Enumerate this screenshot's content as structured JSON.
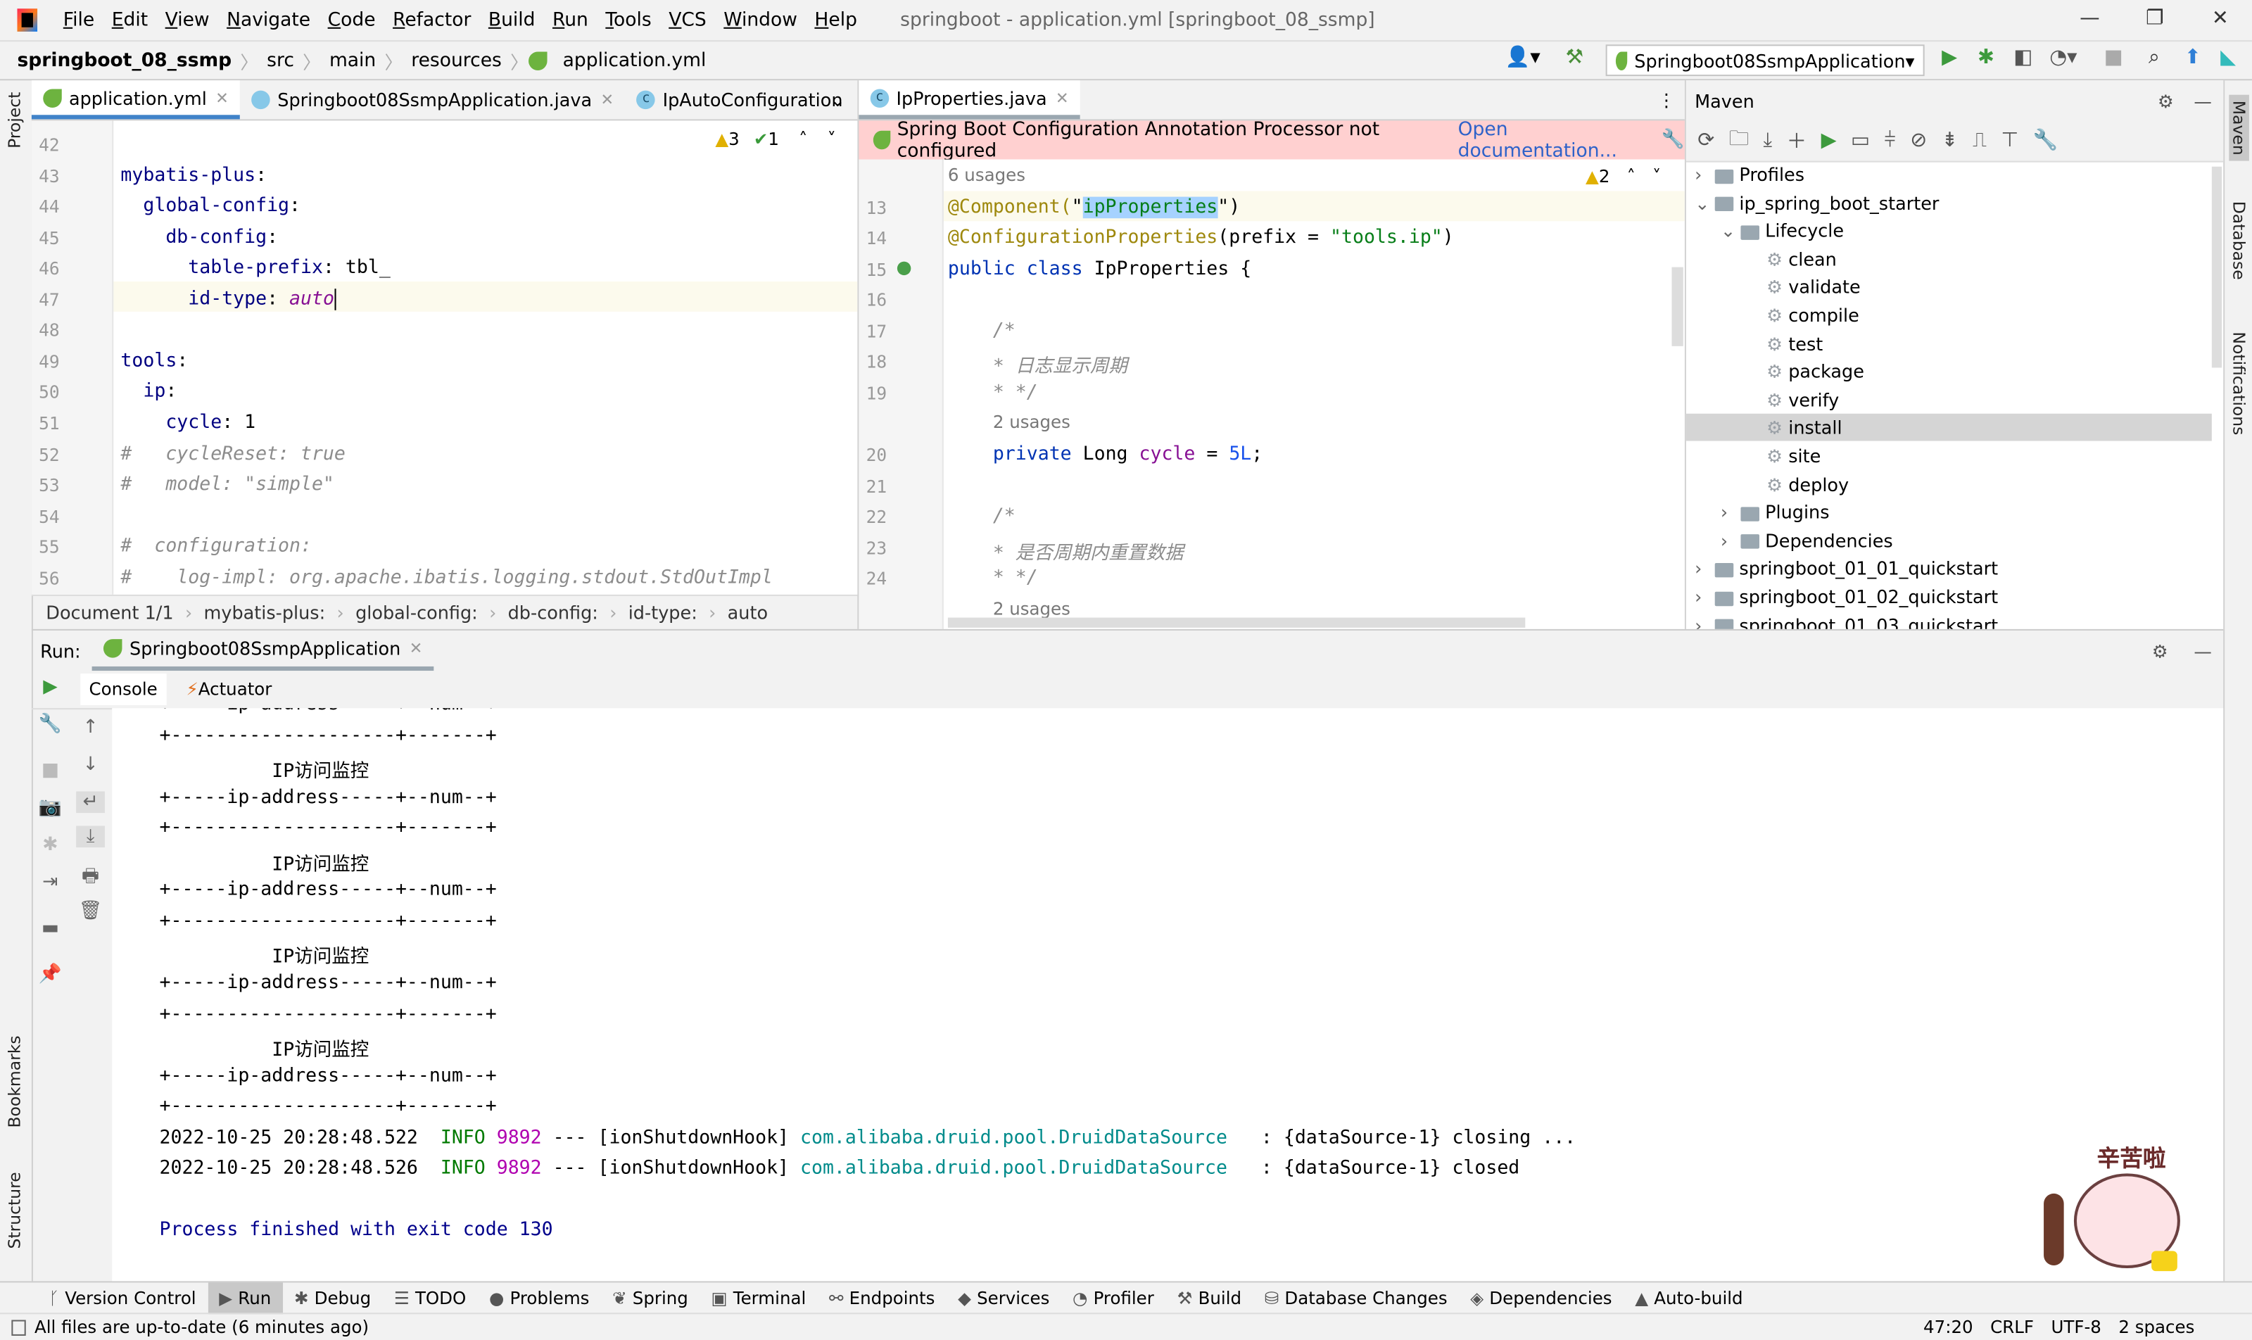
{
  "menu": [
    "File",
    "Edit",
    "View",
    "Navigate",
    "Code",
    "Refactor",
    "Build",
    "Run",
    "Tools",
    "VCS",
    "Window",
    "Help"
  ],
  "window_title": "springboot - application.yml [springboot_08_ssmp]",
  "breadcrumb": [
    "springboot_08_ssmp",
    "src",
    "main",
    "resources",
    "application.yml"
  ],
  "run_config": "Springboot08SsmpApplication",
  "left_strip": [
    "Project",
    "Bookmarks",
    "Structure"
  ],
  "right_strip": [
    "Maven",
    "Database",
    "Notifications"
  ],
  "editor1": {
    "tabs": [
      {
        "label": "application.yml",
        "icon": "spring"
      },
      {
        "label": "Springboot08SsmpApplication.java",
        "icon": "spring-class"
      },
      {
        "label": "IpAutoConfiguration",
        "icon": "class"
      }
    ],
    "warnings": "3",
    "checks": "1",
    "lines": [
      {
        "n": "42",
        "tokens": []
      },
      {
        "n": "43",
        "tokens": [
          {
            "t": "mybatis-plus",
            "c": "key"
          },
          {
            "t": ":"
          }
        ]
      },
      {
        "n": "44",
        "tokens": [
          {
            "t": "  "
          },
          {
            "t": "global-config",
            "c": "key"
          },
          {
            "t": ":"
          }
        ]
      },
      {
        "n": "45",
        "tokens": [
          {
            "t": "    "
          },
          {
            "t": "db-config",
            "c": "key"
          },
          {
            "t": ":"
          }
        ]
      },
      {
        "n": "46",
        "tokens": [
          {
            "t": "      "
          },
          {
            "t": "table-prefix",
            "c": "key"
          },
          {
            "t": ": tbl_"
          }
        ]
      },
      {
        "n": "47",
        "tokens": [
          {
            "t": "      "
          },
          {
            "t": "id-type",
            "c": "key"
          },
          {
            "t": ": "
          },
          {
            "t": "auto",
            "c": "it caret"
          }
        ]
      },
      {
        "n": "48",
        "tokens": []
      },
      {
        "n": "49",
        "tokens": [
          {
            "t": "tools",
            "c": "key"
          },
          {
            "t": ":"
          }
        ]
      },
      {
        "n": "50",
        "tokens": [
          {
            "t": "  "
          },
          {
            "t": "ip",
            "c": "key"
          },
          {
            "t": ":"
          }
        ]
      },
      {
        "n": "51",
        "tokens": [
          {
            "t": "    "
          },
          {
            "t": "cycle",
            "c": "key"
          },
          {
            "t": ": 1"
          }
        ]
      },
      {
        "n": "52",
        "tokens": [
          {
            "t": "#   cycleReset: true",
            "c": "cm"
          }
        ]
      },
      {
        "n": "53",
        "tokens": [
          {
            "t": "#   model: \"simple\"",
            "c": "cm"
          }
        ]
      },
      {
        "n": "54",
        "tokens": []
      },
      {
        "n": "55",
        "tokens": [
          {
            "t": "#  configuration:",
            "c": "cm"
          }
        ]
      },
      {
        "n": "56",
        "tokens": [
          {
            "t": "#    log-impl: org.apache.ibatis.logging.stdout.StdOutImpl",
            "c": "cm"
          }
        ]
      }
    ],
    "path": [
      "Document 1/1",
      "mybatis-plus:",
      "global-config:",
      "db-config:",
      "id-type:",
      "auto"
    ]
  },
  "editor2": {
    "tab": "IpProperties.java",
    "banner": "Spring Boot Configuration Annotation Processor not configured",
    "banner_link": "Open documentation...",
    "warnings": "2",
    "lines": [
      {
        "n": "",
        "tokens": [
          {
            "t": "6 usages",
            "c": "hint"
          }
        ]
      },
      {
        "n": "13",
        "tokens": [
          {
            "t": "@Component(",
            "c": "an"
          },
          {
            "t": "\""
          },
          {
            "t": "ipProperties",
            "c": "s sel"
          },
          {
            "t": "\""
          },
          {
            "t": ")"
          }
        ]
      },
      {
        "n": "14",
        "tokens": [
          {
            "t": "@ConfigurationProperties",
            "c": "an"
          },
          {
            "t": "(prefix = "
          },
          {
            "t": "\"tools.ip\"",
            "c": "s"
          },
          {
            "t": ")"
          }
        ]
      },
      {
        "n": "15",
        "tokens": [
          {
            "t": "public class ",
            "c": "kw"
          },
          {
            "t": "IpProperties {"
          }
        ]
      },
      {
        "n": "16",
        "tokens": []
      },
      {
        "n": "17",
        "tokens": [
          {
            "t": "    /*",
            "c": "cm"
          }
        ]
      },
      {
        "n": "18",
        "tokens": [
          {
            "t": "    * 日志显示周期",
            "c": "cm"
          }
        ]
      },
      {
        "n": "19",
        "tokens": [
          {
            "t": "    * */",
            "c": "cm"
          }
        ]
      },
      {
        "n": "",
        "tokens": [
          {
            "t": "    "
          },
          {
            "t": "2 usages",
            "c": "hint"
          }
        ]
      },
      {
        "n": "20",
        "tokens": [
          {
            "t": "    "
          },
          {
            "t": "private ",
            "c": "kw"
          },
          {
            "t": "Long "
          },
          {
            "t": "cycle",
            "c": "fld"
          },
          {
            "t": " = "
          },
          {
            "t": "5L",
            "c": "num"
          },
          {
            "t": ";"
          }
        ]
      },
      {
        "n": "21",
        "tokens": []
      },
      {
        "n": "22",
        "tokens": [
          {
            "t": "    /*",
            "c": "cm"
          }
        ]
      },
      {
        "n": "23",
        "tokens": [
          {
            "t": "    * 是否周期内重置数据",
            "c": "cm"
          }
        ]
      },
      {
        "n": "24",
        "tokens": [
          {
            "t": "    * */",
            "c": "cm"
          }
        ]
      },
      {
        "n": "",
        "tokens": [
          {
            "t": "    "
          },
          {
            "t": "2 usages",
            "c": "hint"
          }
        ]
      }
    ]
  },
  "maven": {
    "title": "Maven",
    "items": [
      {
        "label": "Profiles",
        "level": 0,
        "chev": ">",
        "icon": "folder"
      },
      {
        "label": "ip_spring_boot_starter",
        "level": 0,
        "chev": "v",
        "icon": "module"
      },
      {
        "label": "Lifecycle",
        "level": 1,
        "chev": "v",
        "icon": "folder"
      },
      {
        "label": "clean",
        "level": 2,
        "icon": "gear"
      },
      {
        "label": "validate",
        "level": 2,
        "icon": "gear"
      },
      {
        "label": "compile",
        "level": 2,
        "icon": "gear"
      },
      {
        "label": "test",
        "level": 2,
        "icon": "gear"
      },
      {
        "label": "package",
        "level": 2,
        "icon": "gear"
      },
      {
        "label": "verify",
        "level": 2,
        "icon": "gear"
      },
      {
        "label": "install",
        "level": 2,
        "icon": "gear",
        "selected": true
      },
      {
        "label": "site",
        "level": 2,
        "icon": "gear"
      },
      {
        "label": "deploy",
        "level": 2,
        "icon": "gear"
      },
      {
        "label": "Plugins",
        "level": 1,
        "chev": ">",
        "icon": "folder"
      },
      {
        "label": "Dependencies",
        "level": 1,
        "chev": ">",
        "icon": "folder"
      },
      {
        "label": "springboot_01_01_quickstart",
        "level": 0,
        "chev": ">",
        "icon": "module"
      },
      {
        "label": "springboot_01_02_quickstart",
        "level": 0,
        "chev": ">",
        "icon": "module"
      },
      {
        "label": "springboot_01_03_quickstart",
        "level": 0,
        "chev": ">",
        "icon": "module"
      }
    ]
  },
  "run": {
    "label": "Run:",
    "tab": "Springboot08SsmpApplication",
    "subtabs": [
      "Console",
      "Actuator"
    ],
    "console": [
      [
        {
          "t": "+-----ip-address-----+--num--+"
        }
      ],
      [
        {
          "t": "+--------------------+-------+"
        }
      ],
      [
        {
          "t": "          IP访问监控"
        }
      ],
      [
        {
          "t": "+-----ip-address-----+--num--+"
        }
      ],
      [
        {
          "t": "+--------------------+-------+"
        }
      ],
      [
        {
          "t": "          IP访问监控"
        }
      ],
      [
        {
          "t": "+-----ip-address-----+--num--+"
        }
      ],
      [
        {
          "t": "+--------------------+-------+"
        }
      ],
      [
        {
          "t": "          IP访问监控"
        }
      ],
      [
        {
          "t": "+-----ip-address-----+--num--+"
        }
      ],
      [
        {
          "t": "+--------------------+-------+"
        }
      ],
      [
        {
          "t": "          IP访问监控"
        }
      ],
      [
        {
          "t": "+-----ip-address-----+--num--+"
        }
      ],
      [
        {
          "t": "+--------------------+-------+"
        }
      ],
      [
        {
          "t": "2022-10-25 20:28:48.522  "
        },
        {
          "t": "INFO",
          "c": "info"
        },
        {
          "t": " "
        },
        {
          "t": "9892",
          "c": "pid"
        },
        {
          "t": " --- [ionShutdownHook] "
        },
        {
          "t": "com.alibaba.druid.pool.DruidDataSource",
          "c": "cls"
        },
        {
          "t": "   : {dataSource-1} closing ..."
        }
      ],
      [
        {
          "t": "2022-10-25 20:28:48.526  "
        },
        {
          "t": "INFO",
          "c": "info"
        },
        {
          "t": " "
        },
        {
          "t": "9892",
          "c": "pid"
        },
        {
          "t": " --- [ionShutdownHook] "
        },
        {
          "t": "com.alibaba.druid.pool.DruidDataSource",
          "c": "cls"
        },
        {
          "t": "   : {dataSource-1} closed"
        }
      ],
      [],
      [
        {
          "t": "Process finished with exit code 130",
          "c": "exit"
        }
      ]
    ],
    "sticker_text": "辛苦啦"
  },
  "bottom_tabs": [
    {
      "label": "Version Control",
      "icon": "branch-icon",
      "glyph": "ᚴ"
    },
    {
      "label": "Run",
      "icon": "run-icon",
      "glyph": "▶",
      "active": true
    },
    {
      "label": "Debug",
      "icon": "bug-icon",
      "glyph": "✱"
    },
    {
      "label": "TODO",
      "icon": "list-icon",
      "glyph": "☰"
    },
    {
      "label": "Problems",
      "icon": "problems-icon",
      "glyph": "●"
    },
    {
      "label": "Spring",
      "icon": "spring-icon",
      "glyph": "❦"
    },
    {
      "label": "Terminal",
      "icon": "terminal-icon",
      "glyph": "▣"
    },
    {
      "label": "Endpoints",
      "icon": "endpoints-icon",
      "glyph": "⚯"
    },
    {
      "label": "Services",
      "icon": "services-icon",
      "glyph": "◆"
    },
    {
      "label": "Profiler",
      "icon": "profiler-icon",
      "glyph": "◔"
    },
    {
      "label": "Build",
      "icon": "hammer-icon",
      "glyph": "⚒"
    },
    {
      "label": "Database Changes",
      "icon": "database-icon",
      "glyph": "⛁"
    },
    {
      "label": "Dependencies",
      "icon": "dependencies-icon",
      "glyph": "◈"
    },
    {
      "label": "Auto-build",
      "icon": "warning-icon",
      "glyph": "▲"
    }
  ],
  "status": {
    "message": "All files are up-to-date (6 minutes ago)",
    "position": "47:20",
    "line_sep": "CRLF",
    "encoding": "UTF-8",
    "indent": "2 spaces"
  },
  "colors": {
    "accent": "#4083c9",
    "banner": "#ffd0d0",
    "selected": "#d5d5d5"
  }
}
